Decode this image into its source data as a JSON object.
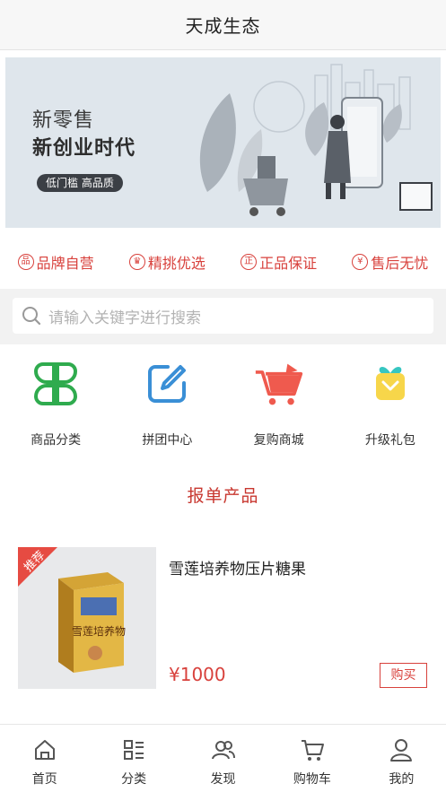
{
  "header": {
    "title": "天成生态"
  },
  "banner": {
    "line1": "新零售",
    "line2": "新创业时代",
    "pill": "低门槛 高品质"
  },
  "features": [
    {
      "label": "品牌自营",
      "icon": "brand-icon",
      "glyph": "品"
    },
    {
      "label": "精挑优选",
      "icon": "crown-icon",
      "glyph": "♛"
    },
    {
      "label": "正品保证",
      "icon": "genuine-icon",
      "glyph": "正"
    },
    {
      "label": "售后无忧",
      "icon": "yen-icon",
      "glyph": "¥"
    }
  ],
  "search": {
    "placeholder": "请输入关键字进行搜索"
  },
  "quick_links": [
    {
      "label": "商品分类",
      "icon": "clover-category-icon"
    },
    {
      "label": "拼团中心",
      "icon": "edit-group-icon"
    },
    {
      "label": "复购商城",
      "icon": "shopping-cart-icon"
    },
    {
      "label": "升级礼包",
      "icon": "gift-icon"
    }
  ],
  "section": {
    "title": "报单产品"
  },
  "product": {
    "name": "雪莲培养物压片糖果",
    "price": "¥1000",
    "buy_label": "购买",
    "badge": "推荐",
    "box_text": "雪莲培养物"
  },
  "tabbar": [
    {
      "label": "首页",
      "icon": "home-icon"
    },
    {
      "label": "分类",
      "icon": "category-icon"
    },
    {
      "label": "发现",
      "icon": "discover-icon"
    },
    {
      "label": "购物车",
      "icon": "cart-icon"
    },
    {
      "label": "我的",
      "icon": "profile-icon"
    }
  ],
  "colors": {
    "accent": "#d8413c",
    "green": "#2fab4e",
    "blue": "#3a8fd6",
    "cart_red": "#ef5a4e",
    "gift_yellow": "#f7d64a",
    "gift_teal": "#36c6c1"
  }
}
